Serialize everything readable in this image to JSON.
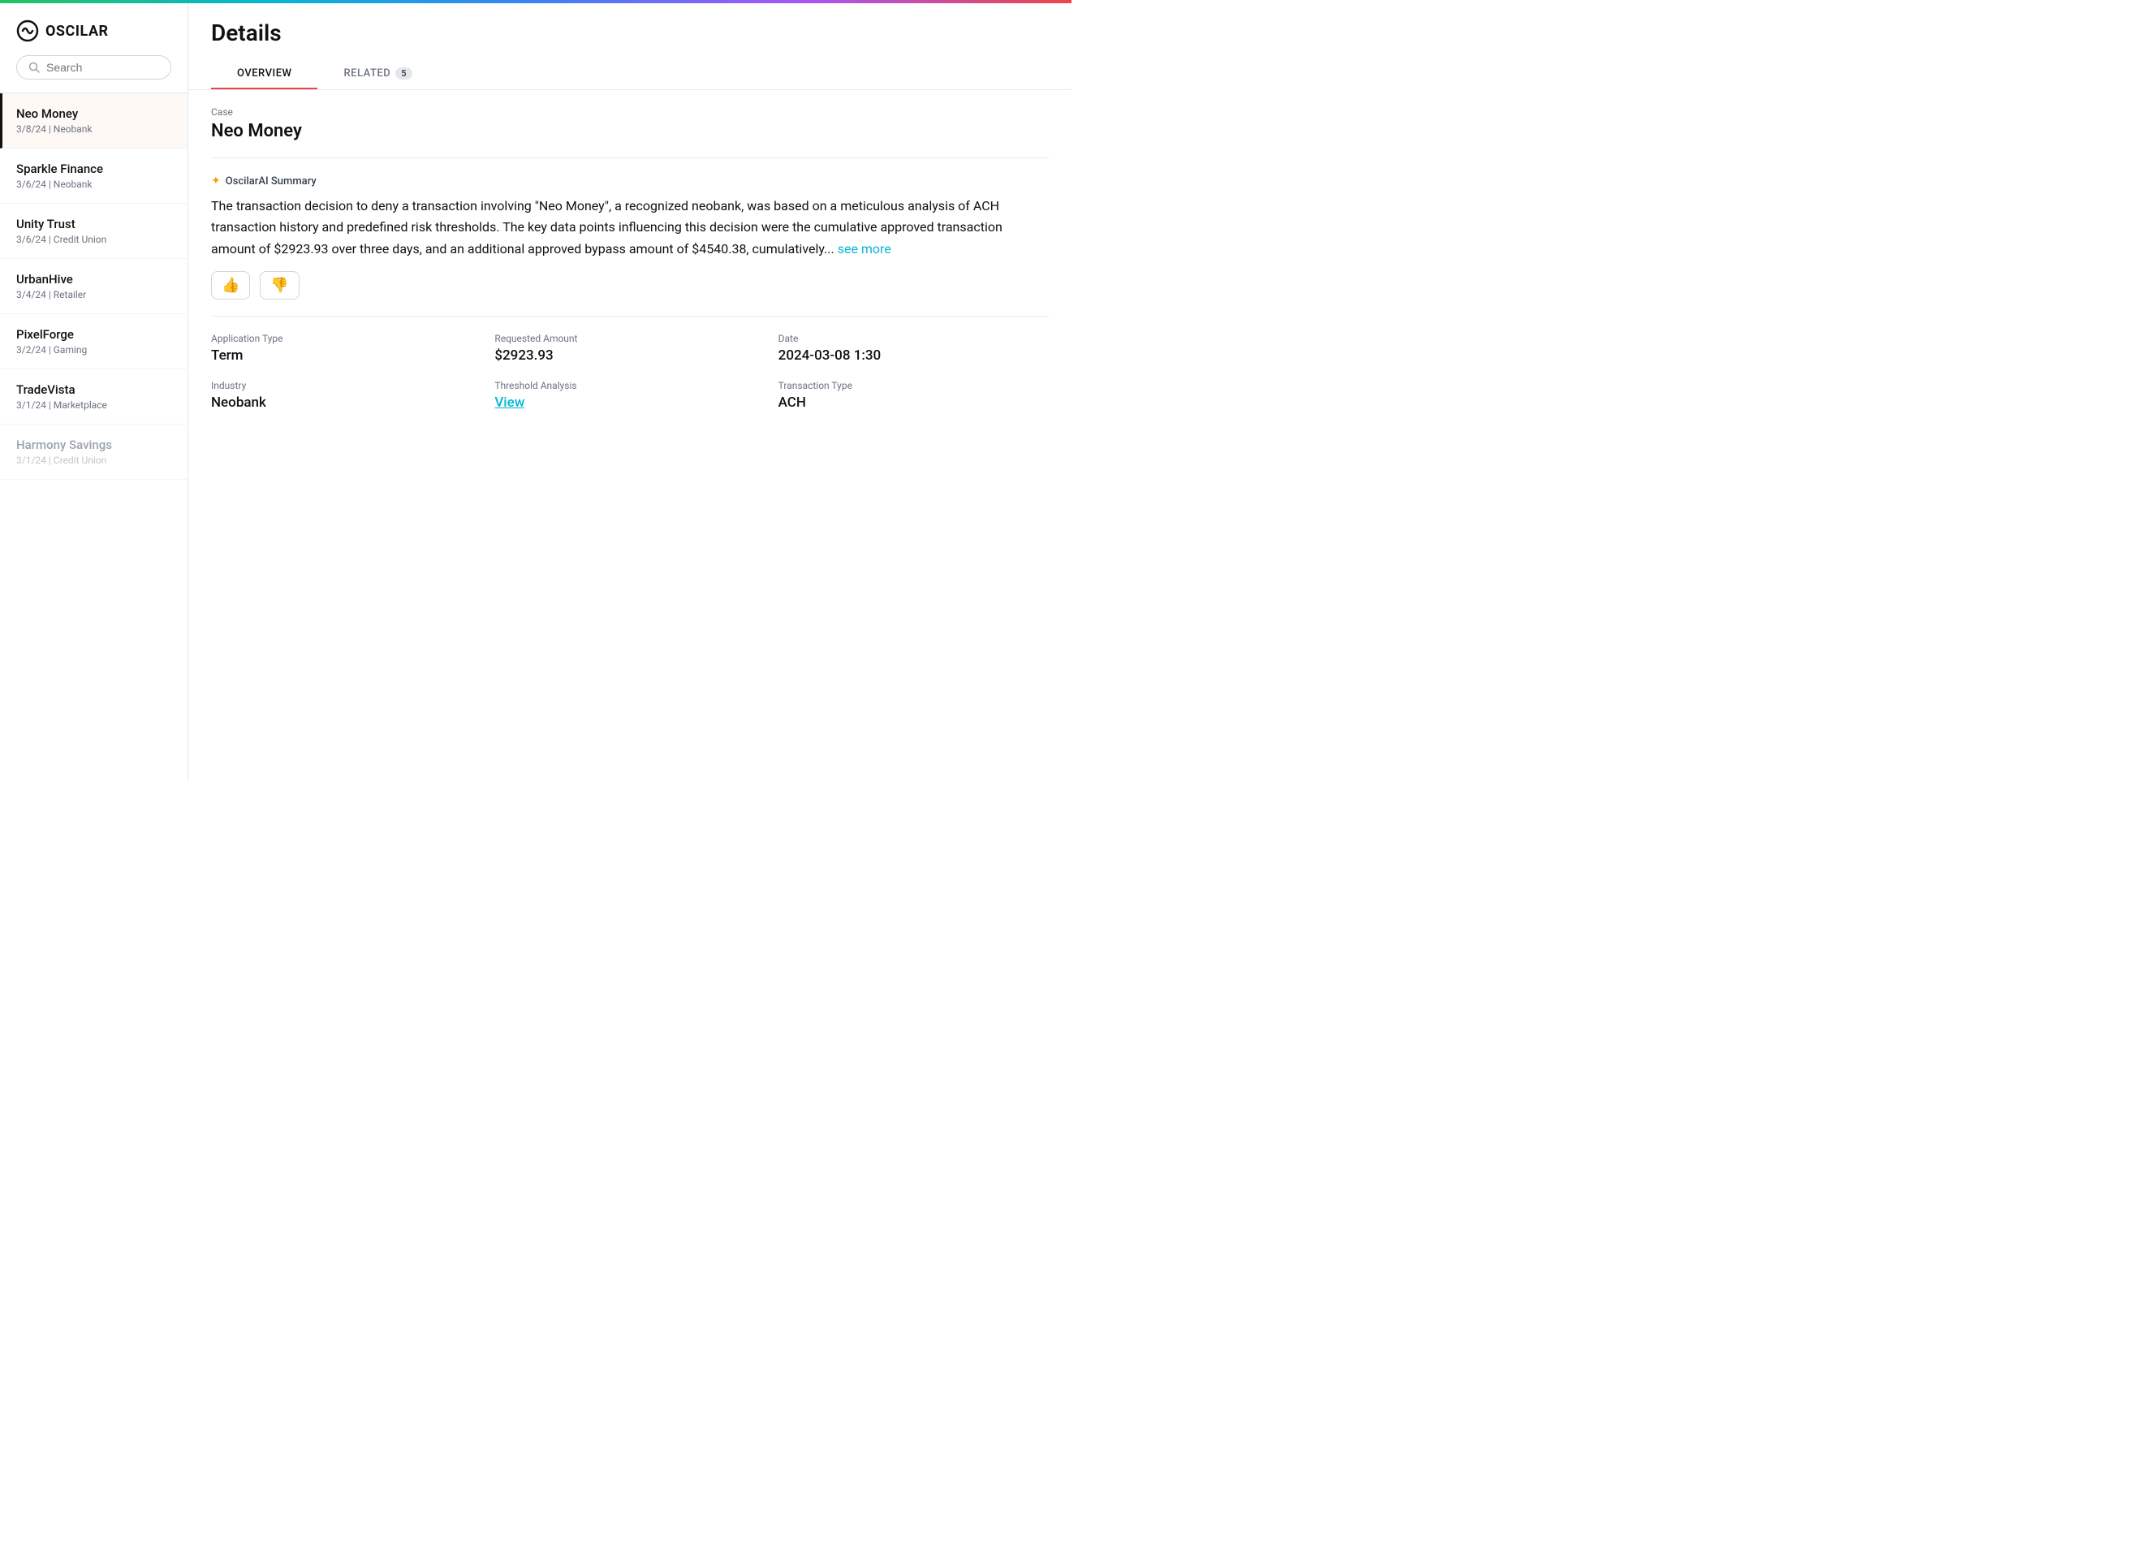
{
  "topBorder": true,
  "logo": {
    "text": "OSCILAR"
  },
  "search": {
    "placeholder": "Search"
  },
  "sidebar": {
    "items": [
      {
        "id": "neo-money",
        "name": "Neo Money",
        "meta": "3/8/24 | Neobank",
        "active": true,
        "faded": false
      },
      {
        "id": "sparkle-finance",
        "name": "Sparkle Finance",
        "meta": "3/6/24 | Neobank",
        "active": false,
        "faded": false
      },
      {
        "id": "unity-trust",
        "name": "Unity Trust",
        "meta": "3/6/24 | Credit Union",
        "active": false,
        "faded": false
      },
      {
        "id": "urbanhive",
        "name": "UrbanHive",
        "meta": "3/4/24 | Retailer",
        "active": false,
        "faded": false
      },
      {
        "id": "pixelforge",
        "name": "PixelForge",
        "meta": "3/2/24 | Gaming",
        "active": false,
        "faded": false
      },
      {
        "id": "tradevista",
        "name": "TradeVista",
        "meta": "3/1/24 | Marketplace",
        "active": false,
        "faded": false
      },
      {
        "id": "harmony-savings",
        "name": "Harmony Savings",
        "meta": "3/1/24 | Credit Union",
        "active": false,
        "faded": true
      }
    ]
  },
  "main": {
    "title": "Details",
    "tabs": [
      {
        "id": "overview",
        "label": "OVERVIEW",
        "active": true,
        "badge": null
      },
      {
        "id": "related",
        "label": "RELATED",
        "active": false,
        "badge": "5"
      }
    ],
    "case": {
      "label": "Case",
      "value": "Neo Money"
    },
    "aiSummary": {
      "iconLabel": "✦",
      "title": "OscilarAI Summary",
      "text": "The transaction decision to deny a transaction involving \"Neo Money\", a recognized neobank, was based on a meticulous analysis of ACH transaction history and predefined risk thresholds. The key data points influencing this decision were the cumulative approved transaction amount of $2923.93 over three days, and an additional approved bypass amount of $4540.38, cumulatively...",
      "seeMoreLabel": "see more"
    },
    "feedback": {
      "thumbsUpLabel": "👍",
      "thumbsDownLabel": "👎"
    },
    "details": [
      {
        "rows": [
          [
            {
              "label": "Application Type",
              "value": "Term",
              "type": "text"
            },
            {
              "label": "Requested Amount",
              "value": "$2923.93",
              "type": "text"
            },
            {
              "label": "Date",
              "value": "2024-03-08 1:30",
              "type": "text"
            }
          ],
          [
            {
              "label": "Industry",
              "value": "Neobank",
              "type": "text"
            },
            {
              "label": "Threshold Analysis",
              "value": "View",
              "type": "link"
            },
            {
              "label": "Transaction Type",
              "value": "ACH",
              "type": "text"
            }
          ]
        ]
      }
    ]
  }
}
